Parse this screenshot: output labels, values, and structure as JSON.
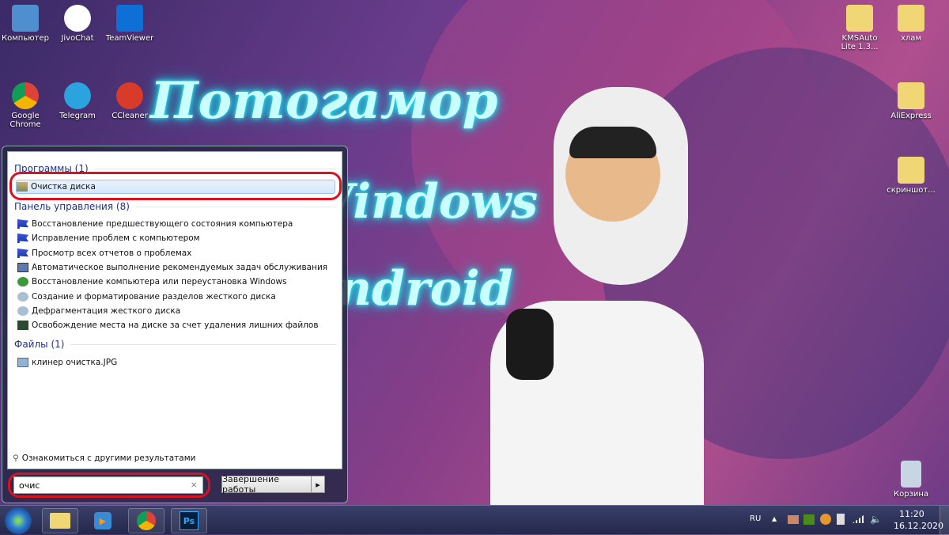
{
  "wallpaper": {
    "logo_lines": [
      "Потогамор",
      "Windows",
      "Android"
    ]
  },
  "desktop_left": [
    {
      "label": "Компьютер",
      "icon": "computer-icon",
      "color": "#4f8fd0"
    },
    {
      "label": "JivoChat",
      "icon": "jivochat-icon",
      "color": "#ffffff"
    },
    {
      "label": "TeamViewer",
      "icon": "teamviewer-icon",
      "color": "#0e6fd6"
    },
    {
      "label": "Google Chrome",
      "icon": "chrome-icon",
      "color": "#db4437"
    },
    {
      "label": "Telegram",
      "icon": "telegram-icon",
      "color": "#2aa3df"
    },
    {
      "label": "CCleaner",
      "icon": "ccleaner-icon",
      "color": "#d83b2a"
    }
  ],
  "desktop_right": [
    {
      "label": "KMSAuto Lite 1.3...",
      "icon": "folder-icon"
    },
    {
      "label": "хлам",
      "icon": "folder-icon"
    },
    {
      "label": "AliExpress",
      "icon": "folder-icon"
    },
    {
      "label": "скриншот...",
      "icon": "folder-icon"
    },
    {
      "label": "Корзина",
      "icon": "recycle-bin-icon"
    }
  ],
  "start_menu": {
    "programs_header": "Программы (1)",
    "programs": [
      "Очистка диска"
    ],
    "control_header": "Панель управления (8)",
    "control": [
      "Восстановление предшествующего состояния компьютера",
      "Исправление проблем с компьютером",
      "Просмотр всех отчетов о проблемах",
      "Автоматическое выполнение рекомендуемых задач обслуживания",
      "Восстановление компьютера или переустановка Windows",
      "Создание и форматирование разделов жесткого диска",
      "Дефрагментация жесткого диска",
      "Освобождение места на диске за счет удаления лишних файлов"
    ],
    "files_header": "Файлы (1)",
    "files": [
      "клинер очистка.JPG"
    ],
    "more_results": "Ознакомиться с другими результатами",
    "search_value": "очис",
    "clear": "×",
    "shutdown": "Завершение работы",
    "shutdown_arrow": "▸"
  },
  "tray": {
    "lang": "RU",
    "time": "11:20",
    "date": "16.12.2020",
    "arrow": "▲"
  },
  "highlight_color": "#d8121e"
}
